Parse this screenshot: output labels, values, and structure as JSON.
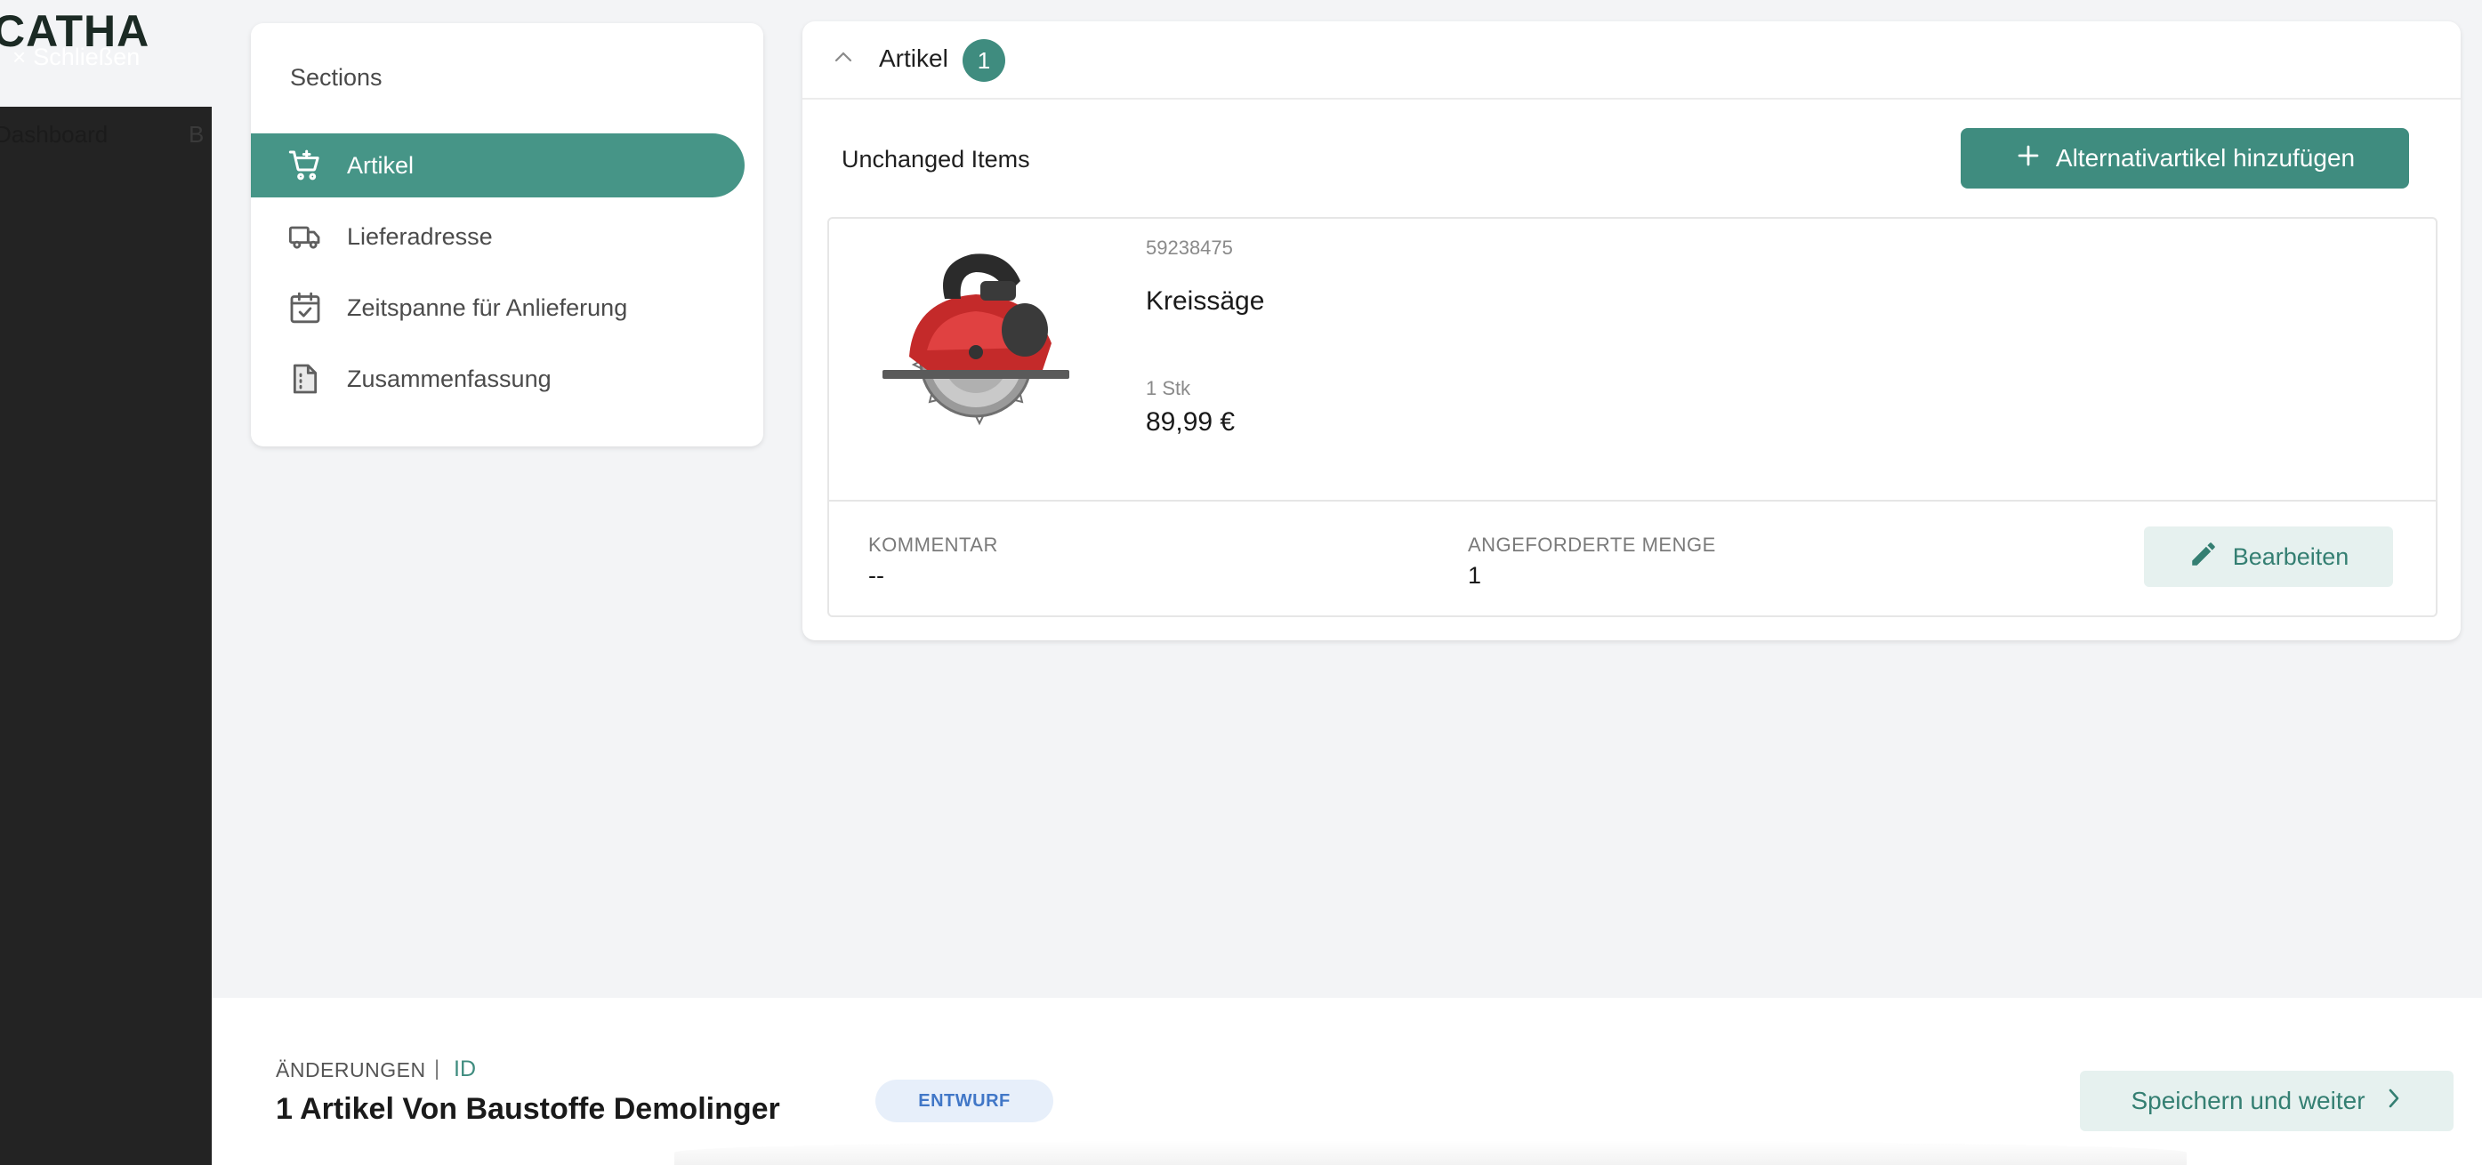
{
  "app": {
    "logo_text": "CATHA",
    "close_label": "Schließen",
    "nav_items": [
      "Dashboard",
      "B"
    ]
  },
  "sections": {
    "title": "Sections",
    "items": [
      {
        "label": "Artikel",
        "icon": "cart-icon",
        "active": true
      },
      {
        "label": "Lieferadresse",
        "icon": "truck-icon",
        "active": false
      },
      {
        "label": "Zeitspanne für Anlieferung",
        "icon": "calendar-check-icon",
        "active": false
      },
      {
        "label": "Zusammenfassung",
        "icon": "summary-icon",
        "active": false
      }
    ]
  },
  "articles": {
    "title": "Artikel",
    "count": "1",
    "subtitle": "Unchanged Items",
    "add_button_label": "Alternativartikel hinzufügen",
    "item": {
      "sku": "59238475",
      "name": "Kreissäge",
      "quantity_unit": "1 Stk",
      "price": "89,99 €",
      "comment_label": "KOMMENTAR",
      "comment_value": "--",
      "requested_qty_label": "ANGEFORDERTE MENGE",
      "requested_qty_value": "1",
      "edit_label": "Bearbeiten"
    }
  },
  "footer": {
    "changes_label": "ÄNDERUNGEN",
    "separator": "|",
    "id_label": "ID",
    "title": "1 Artikel Von Baustoffe Demolinger",
    "status": "ENTWURF",
    "save_label": "Speichern und weiter"
  },
  "colors": {
    "accent": "#3f8c7f",
    "active_nav": "#469587",
    "overlay": "#232323",
    "status_bg": "#e7effa",
    "status_text": "#4177c7"
  }
}
